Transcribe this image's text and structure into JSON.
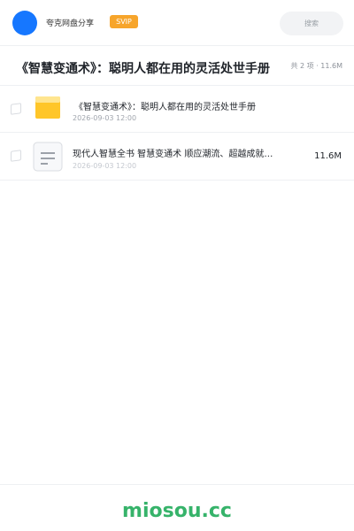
{
  "header": {
    "brand_text": "夸克网盘分享",
    "svip_label": "SVIP",
    "search_placeholder": "搜索"
  },
  "share": {
    "title": "《智慧变通术》：聪明人都在用的灵活处世手册",
    "summary": "共 2 项 · 11.6M"
  },
  "files": [
    {
      "name": "《智慧变通术》：聪明人都在用的灵活处世手册",
      "date": "2026-09-03 12:00",
      "icon": "folder-icon"
    },
    {
      "name": "现代人智慧全书 智慧变通术 顺应潮流、超越成就…",
      "date": "2026-09-03 12:00",
      "size": "11.6M",
      "icon": "document-icon"
    }
  ],
  "footer": {
    "watermark": "miosou.cc"
  },
  "colors": {
    "accent": "#1677ff",
    "svip": "#f7a52b",
    "watermark": "#36b36a",
    "folder": "#ffc629"
  }
}
